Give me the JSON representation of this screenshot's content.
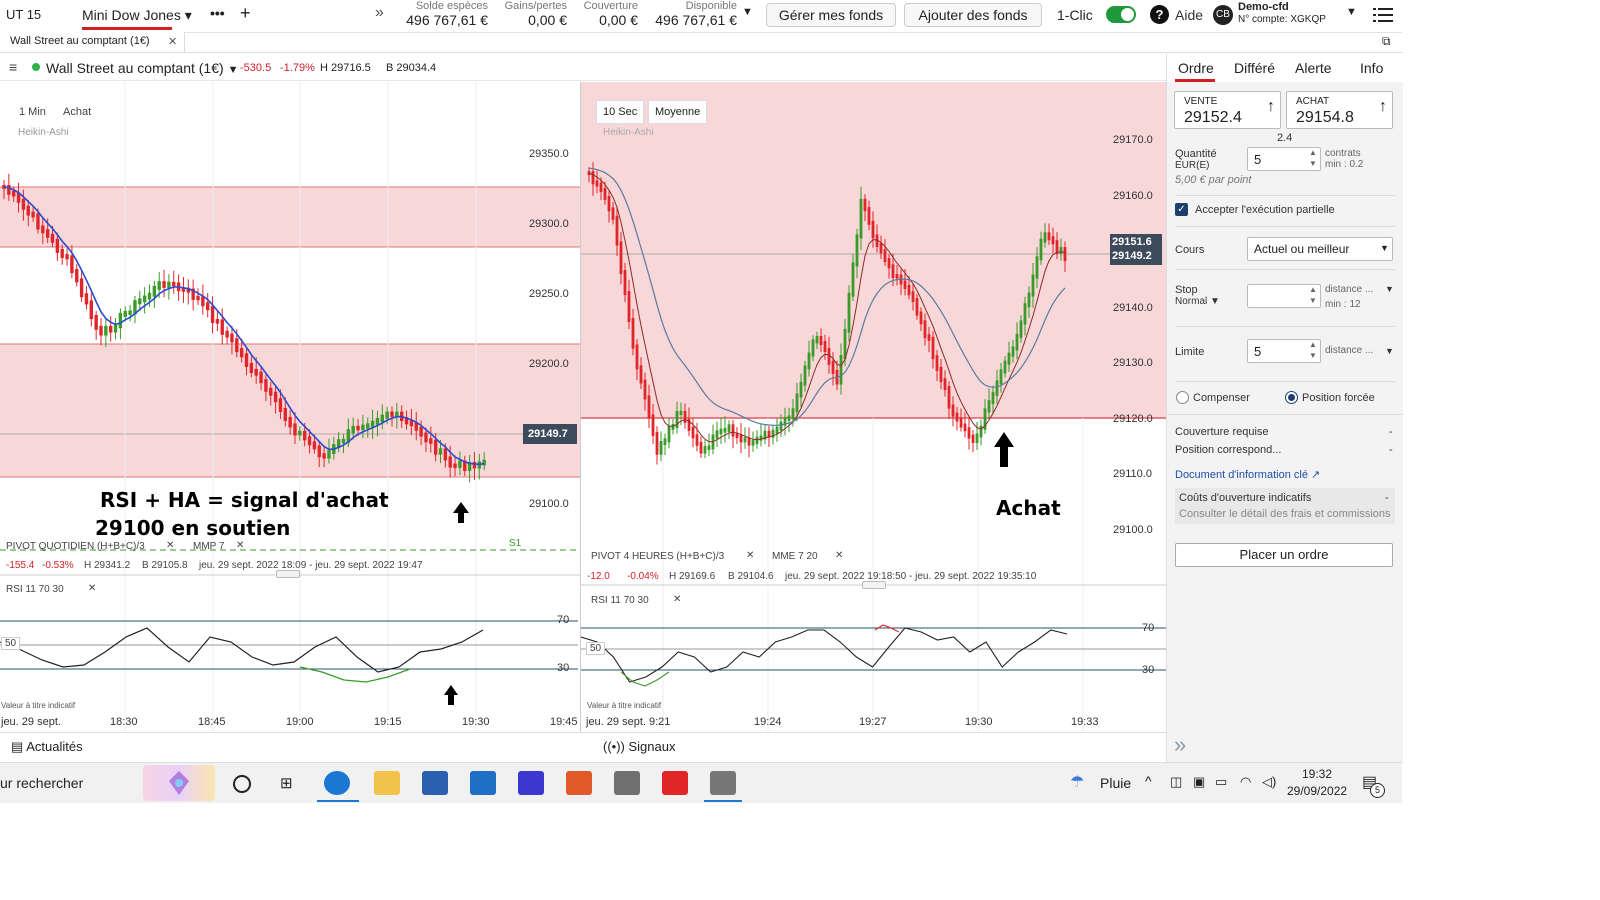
{
  "topbar": {
    "timeframe": "UT 15",
    "instrument": "Mini Dow Jones",
    "more": "•••",
    "add": "+",
    "cash_label": "Solde espèces",
    "cash_value": "496 767,61 €",
    "pnl_label": "Gains/pertes",
    "pnl_value": "0,00 €",
    "cover_label": "Couverture",
    "cover_value": "0,00 €",
    "avail_label": "Disponible",
    "avail_value": "496 767,61 €",
    "manage_funds": "Gérer mes fonds",
    "add_funds": "Ajouter des fonds",
    "one_click": "1-Clic",
    "help": "Aide",
    "account_initials": "CB",
    "account_name": "Demo-cfd",
    "account_number": "N° compte: XGKQP"
  },
  "tab": {
    "label": "Wall Street au comptant (1€)",
    "close": "✕"
  },
  "info": {
    "name": "Wall Street au comptant (1€)",
    "change": "-530.5",
    "change_pct": "-1.79%",
    "high": "H 29716.5",
    "low": "B 29034.4"
  },
  "left_chart": {
    "interval": "1 Min",
    "mode": "Achat",
    "style": "Heikin-Ashi",
    "price_ticks": [
      "29350.0",
      "29300.0",
      "29250.0",
      "29200.0",
      "29149.7",
      "29100.0"
    ],
    "current_price": "29149.7",
    "pivot": "PIVOT   QUOTIDIEN   (H+B+C)/3",
    "mmp": "MMP  7",
    "s1": "S1",
    "stats_change": "-155.4",
    "stats_pct": "-0.53%",
    "stats_high": "H 29341.2",
    "stats_low": "B 29105.8",
    "stats_range": "jeu. 29 sept. 2022 18:09 - jeu. 29 sept. 2022 19:47",
    "rsi_label": "RSI   11   70   30",
    "rsi_levels": [
      "70",
      "50",
      "30"
    ],
    "indicative": "Valeur à titre indicatif",
    "time_ticks": [
      "jeu. 29 sept.",
      "18:30",
      "18:45",
      "19:00",
      "19:15",
      "19:30",
      "19:45"
    ],
    "annotation1": "RSI + HA = signal d'achat",
    "annotation2": "29100 en soutien",
    "footer": "Actualités"
  },
  "right_chart": {
    "interval": "10 Sec",
    "mode": "Moyenne",
    "style": "Heikin-Ashi",
    "price_ticks": [
      "29170.0",
      "29160.0",
      "29150.0",
      "29140.0",
      "29130.0",
      "29120.0",
      "29110.0",
      "29100.0"
    ],
    "price_sell": "29151.6",
    "price_buy": "29149.2",
    "pivot": "PIVOT   4 HEURES   (H+B+C)/3",
    "mme": "MME   7   20",
    "stats_change": "-12.0",
    "stats_pct": "-0.04%",
    "stats_high": "H 29169.6",
    "stats_low": "B 29104.6",
    "stats_range": "jeu. 29 sept. 2022 19:18:50 - jeu. 29 sept. 2022 19:35:10",
    "rsi_label": "RSI   11   70   30",
    "rsi_levels": [
      "70",
      "50",
      "30"
    ],
    "indicative": "Valeur à titre indicatif",
    "time_ticks": [
      "jeu. 29 sept.  9:21",
      "19:24",
      "19:27",
      "19:30",
      "19:33"
    ],
    "annotation": "Achat",
    "footer": "Signaux"
  },
  "order_panel": {
    "tabs": [
      "Ordre",
      "Différé",
      "Alerte",
      "Info"
    ],
    "sell_label": "VENTE",
    "sell_price": "29152.4",
    "buy_label": "ACHAT",
    "buy_price": "29154.8",
    "spread": "2.4",
    "qty_label": "Quantité",
    "qty_unit": "EUR(E)",
    "qty_value": "5",
    "qty_contracts": "contrats",
    "qty_min": "min : 0.2",
    "per_point": "5,00 € par point",
    "partial": "Accepter l'exécution partielle",
    "price_label": "Cours",
    "price_select": "Actuel ou meilleur",
    "stop_label": "Stop",
    "stop_type": "Normal",
    "stop_distance": "distance ...",
    "stop_min": "min : 12",
    "limit_label": "Limite",
    "limit_value": "5",
    "limit_distance": "distance ...",
    "compensate": "Compenser",
    "forced": "Position forcée",
    "coverage": "Couverture requise",
    "coverage_val": "-",
    "position": "Position correspond...",
    "position_val": "-",
    "doc": "Document d'information clé",
    "costs_title": "Coûts d'ouverture indicatifs",
    "costs_val": "-",
    "costs_detail": "Consulter le détail des frais et commissions",
    "place_order": "Placer un ordre"
  },
  "taskbar": {
    "search": "ur rechercher",
    "weather": "Pluie",
    "time": "19:32",
    "date": "29/09/2022",
    "notif": "5"
  },
  "colors": {
    "up": "#3a9a2a",
    "down": "#e0262a",
    "zone": "#f7d7d8",
    "accent": "#d21f26"
  }
}
